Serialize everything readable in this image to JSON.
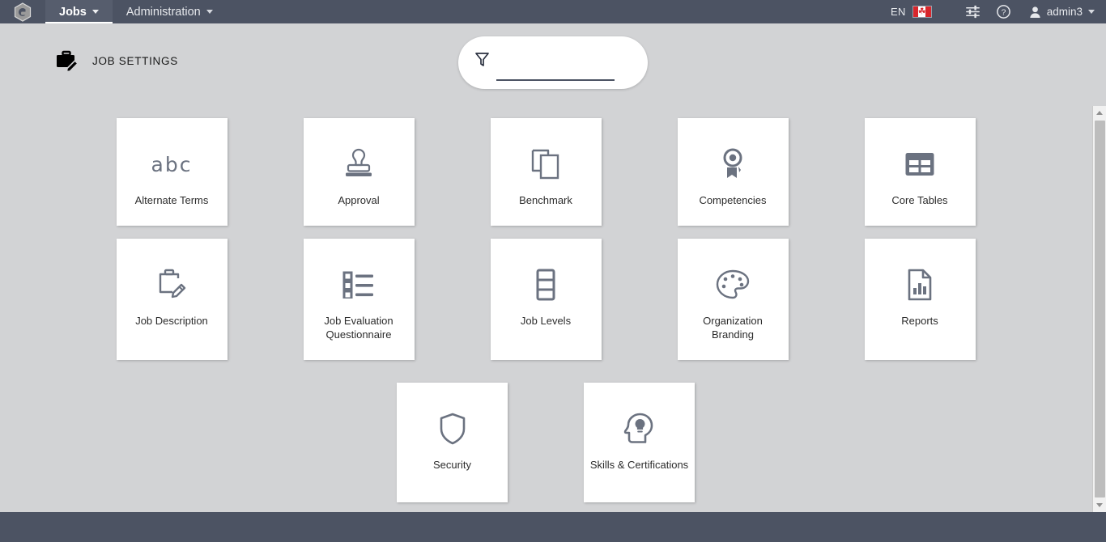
{
  "app": {
    "logo_icon": "hexagon-logo-icon",
    "accent_dark": "#4c5363",
    "page_background": "#d2d3d5",
    "tile_icon_color": "#6b7280"
  },
  "topnav": {
    "tabs": [
      {
        "label": "Jobs",
        "active": true,
        "icon": "chevron-down-icon"
      },
      {
        "label": "Administration",
        "active": false,
        "icon": "chevron-down-icon"
      }
    ],
    "language": "EN",
    "flag": "canada-flag-icon",
    "flag_symbol": "☘",
    "settings_icon": "sliders-settings-icon",
    "help_icon": "help-circle-icon",
    "user": {
      "name": "admin3",
      "avatar_icon": "user-avatar-icon",
      "caret_icon": "chevron-down-icon"
    }
  },
  "header": {
    "icon": "briefcase-edit-icon",
    "title": "JOB SETTINGS"
  },
  "filter": {
    "icon": "funnel-filter-icon",
    "value": "",
    "placeholder": ""
  },
  "tiles": {
    "row1": [
      {
        "label": "Alternate Terms",
        "icon": "abc-text-icon",
        "glyph": "abc"
      },
      {
        "label": "Approval",
        "icon": "rubber-stamp-icon"
      },
      {
        "label": "Benchmark",
        "icon": "copy-documents-icon"
      },
      {
        "label": "Competencies",
        "icon": "award-medal-icon"
      },
      {
        "label": "Core Tables",
        "icon": "grid-table-icon"
      }
    ],
    "row2": [
      {
        "label": "Job Description",
        "icon": "briefcase-pencil-icon"
      },
      {
        "label": "Job Evaluation Questionnaire",
        "icon": "checklist-icon"
      },
      {
        "label": "Job Levels",
        "icon": "stacked-levels-icon"
      },
      {
        "label": "Organization Branding",
        "icon": "paint-palette-icon"
      },
      {
        "label": "Reports",
        "icon": "document-bar-chart-icon"
      }
    ],
    "row3": [
      {
        "label": "Security",
        "icon": "shield-icon"
      },
      {
        "label": "Skills & Certifications",
        "icon": "head-lightbulb-icon"
      }
    ]
  },
  "scrollbar": {
    "up_icon": "scroll-up-arrow-icon",
    "down_icon": "scroll-down-arrow-icon"
  }
}
